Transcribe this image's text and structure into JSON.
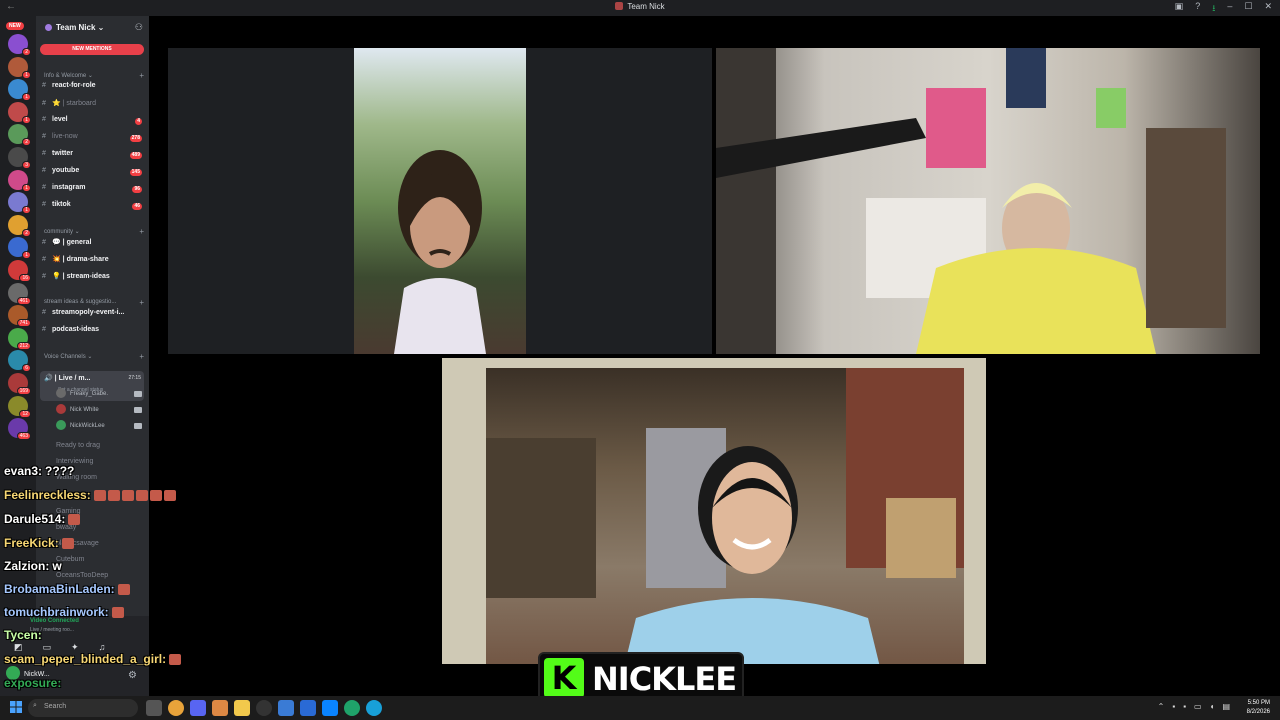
{
  "window": {
    "title": "Team Nick"
  },
  "server": {
    "name": "Team Nick",
    "new_label": "NEW",
    "new_mentions": "NEW MENTIONS",
    "server_badges": [
      "2",
      "1",
      "1",
      "1",
      "2",
      "3",
      "1",
      "1",
      "2",
      "1",
      "16",
      "461",
      "741",
      "212",
      "6",
      "169",
      "12",
      "463"
    ],
    "categories": {
      "info": "Info & Welcome",
      "community": "community",
      "stream": "stream ideas & suggestio...",
      "voice": "Voice Channels"
    },
    "channels": [
      {
        "name": "react-for-role",
        "count": ""
      },
      {
        "name": "⭐ | starboard",
        "count": ""
      },
      {
        "name": "level",
        "count": "4"
      },
      {
        "name": "live-now",
        "count": "278"
      },
      {
        "name": "twitter",
        "count": "489"
      },
      {
        "name": "youtube",
        "count": "145"
      },
      {
        "name": "instagram",
        "count": "96"
      },
      {
        "name": "tiktok",
        "count": "46"
      },
      {
        "name": "💬 | general",
        "count": ""
      },
      {
        "name": "💥 | drama-share",
        "count": ""
      },
      {
        "name": "💡 | stream-ideas",
        "count": ""
      },
      {
        "name": "streamopoly-event-i...",
        "count": ""
      },
      {
        "name": "podcast-ideas",
        "count": ""
      }
    ],
    "voice": {
      "channel": "| Live / m...",
      "timer": "27:15",
      "status": "Set a channel status",
      "users": [
        "Freaky_Gabe.",
        "Nick White",
        "NickWickLee"
      ],
      "others": [
        "Ready to drag",
        "Interviewing",
        "Waiting room",
        "Gaming",
        "bwaay",
        "blanccsavage",
        "Cutebum",
        "OceansTooDeep"
      ]
    },
    "user_panel": {
      "status": "Video Connected",
      "substatus": "Live / meeting roo...",
      "username": "NickW...",
      "substat": "Streaming"
    }
  },
  "chat_overlay": [
    {
      "user": "evan3:",
      "msg": "????",
      "color": "#ffffff"
    },
    {
      "user": "Feelinreckless:",
      "msg": "",
      "color": "#f7d774",
      "emotes": 6
    },
    {
      "user": "Darule514:",
      "msg": "",
      "color": "#ffffff",
      "emotes": 1
    },
    {
      "user": "FreeKick:",
      "msg": "",
      "color": "#f7d774",
      "emotes": 1
    },
    {
      "user": "Zalzion:",
      "msg": "w",
      "color": "#ffffff"
    },
    {
      "user": "BrobamaBinLaden:",
      "msg": "",
      "color": "#a6c8ff",
      "emotes": 1
    },
    {
      "user": "tomuchbrainwork:",
      "msg": "",
      "color": "#a6c8ff",
      "emotes": 1
    },
    {
      "user": "Tycen:",
      "msg": "",
      "color": "#c8ffa6"
    },
    {
      "user": "scam_peper_blinded_a_girl:",
      "msg": "",
      "color": "#f7d774",
      "emotes": 1
    },
    {
      "user": "exposure:",
      "msg": "",
      "color": "#33aa55"
    }
  ],
  "stream": {
    "nameplate_logo": "K",
    "nameplate_name": "NICKLEE"
  },
  "taskbar": {
    "search": "Search",
    "time": "5:50 PM",
    "date": "8/2/2026"
  },
  "colors": {
    "accent": "#5865f2",
    "danger": "#f23f43",
    "kick": "#53fc18"
  }
}
